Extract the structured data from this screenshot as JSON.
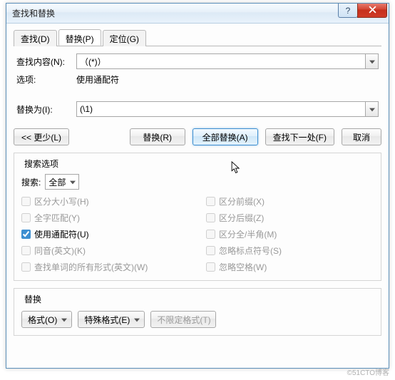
{
  "window": {
    "title": "查找和替换"
  },
  "tabs": {
    "find": "查找(D)",
    "replace": "替换(P)",
    "goto": "定位(G)"
  },
  "form": {
    "find_label": "查找内容(N):",
    "find_value": "（(*)）",
    "options_label": "选项:",
    "options_value": "使用通配符",
    "replace_label": "替换为(I):",
    "replace_value": "(\\1)"
  },
  "buttons": {
    "less": "<< 更少(L)",
    "replace_one": "替换(R)",
    "replace_all": "全部替换(A)",
    "find_next": "查找下一处(F)",
    "cancel": "取消"
  },
  "search_options": {
    "legend": "搜索选项",
    "search_label": "搜索:",
    "search_value": "全部",
    "match_case": "区分大小写(H)",
    "whole_word": "全字匹配(Y)",
    "wildcards": "使用通配符(U)",
    "sounds_like": "同音(英文)(K)",
    "all_forms": "查找单词的所有形式(英文)(W)",
    "match_prefix": "区分前缀(X)",
    "match_suffix": "区分后缀(Z)",
    "match_width": "区分全/半角(M)",
    "ignore_punct": "忽略标点符号(S)",
    "ignore_space": "忽略空格(W)"
  },
  "replace_section": {
    "legend": "替换",
    "format": "格式(O)",
    "special": "特殊格式(E)",
    "no_format": "不限定格式(T)"
  },
  "watermark": "©51CTO博客"
}
